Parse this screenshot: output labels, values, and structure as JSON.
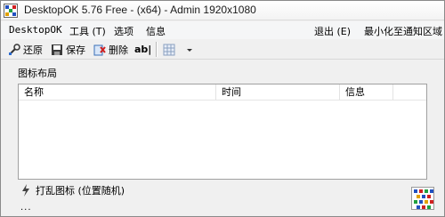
{
  "window": {
    "title": "DesktopOK 5.76 Free - (x64) - Admin 1920x1080"
  },
  "menu": {
    "left": [
      "DesktopOK",
      "工具 (T)",
      "选项",
      "信息"
    ],
    "right": [
      "退出 (E)",
      "最小化至通知区域"
    ]
  },
  "toolbar": {
    "restore_label": "还原",
    "save_label": "保存",
    "delete_label": "删除",
    "rename_label": "ab|"
  },
  "group": {
    "label": "图标布局"
  },
  "table": {
    "columns": [
      "名称",
      "时间",
      "信息"
    ]
  },
  "status": {
    "shuffle_label": "打乱图标 (位置随机)",
    "more": "..."
  },
  "colors": {
    "window_bg": "#f0f0f0",
    "list_bg": "#ffffff",
    "border": "#a0a0a0"
  }
}
